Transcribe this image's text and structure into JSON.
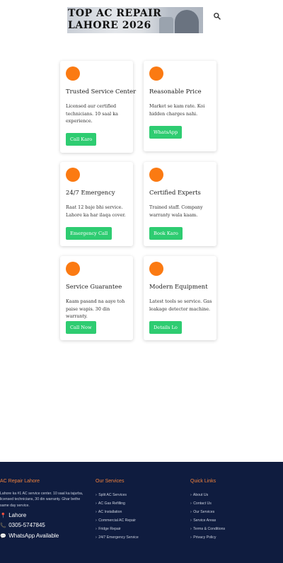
{
  "header": {
    "title": "TOP AC REPAIR LAHORE 2026",
    "search_icon": "search-icon"
  },
  "features": [
    {
      "title": "Trusted Service Center",
      "desc": "Licensed aur certified technicians. 10 saal ka experience.",
      "cta": "Call Karo"
    },
    {
      "title": "Reasonable Price",
      "desc": "Market se kam rate. Koi hidden charges nahi.",
      "cta": "WhatsApp"
    },
    {
      "title": "24/7 Emergency",
      "desc": "Raat 12 baje bhi service. Lahore ka har ilaqa cover.",
      "cta": "Emergency Call"
    },
    {
      "title": "Certified Experts",
      "desc": "Trained staff. Company warranty wala kaam.",
      "cta": "Book Karo"
    },
    {
      "title": "Service Guarantee",
      "desc": "Kaam pasand na aaye toh paise wapis. 30 din warranty.",
      "cta": "Call Now"
    },
    {
      "title": "Modern Equipment",
      "desc": "Latest tools se service. Gas leakage detector machine.",
      "cta": "Details Lo"
    }
  ],
  "footer": {
    "about": {
      "heading": "AC Repair Lahore",
      "text": "Lahore ka #1 AC service center. 10 saal ka tajurba, licensed technicians, 30 din warranty. Ghar bethe same day service.",
      "location": "Lahore",
      "phone": "0305-5747845",
      "whatsapp": "WhatsApp Available"
    },
    "services": {
      "heading": "Our Services",
      "items": [
        "Split AC Services",
        "AC Gas Refilling",
        "AC Installation",
        "Commercial AC Repair",
        "Fridge Repair",
        "24/7 Emergency Service"
      ]
    },
    "quick_links": {
      "heading": "Quick Links",
      "items": [
        "About Us",
        "Contact Us",
        "Our Services",
        "Service Areas",
        "Terms & Conditions",
        "Privacy Policy"
      ]
    }
  },
  "colors": {
    "accent_orange": "#fb7a12",
    "button_green": "#2ecc71",
    "footer_bg": "#0f1c3f",
    "footer_heading": "#f0813c"
  }
}
